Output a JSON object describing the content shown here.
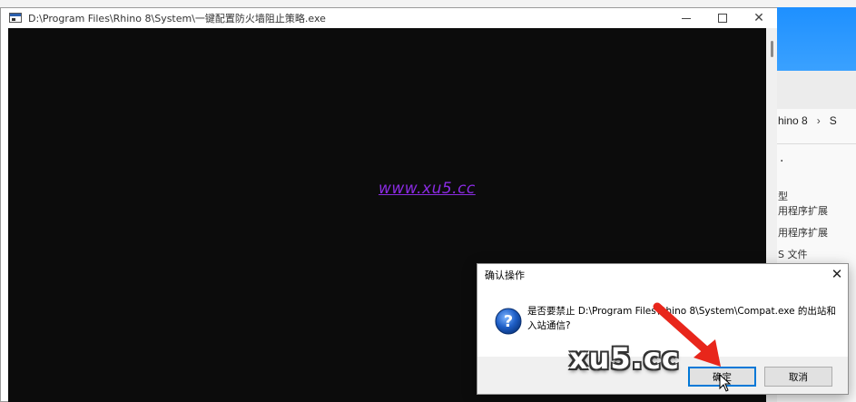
{
  "explorer": {
    "breadcrumb": [
      "hino 8",
      "S"
    ],
    "items": [
      "型",
      "用程序扩展",
      "用程序扩展",
      "S 文件"
    ]
  },
  "console": {
    "title": "D:\\Program Files\\Rhino 8\\System\\一键配置防火墙阻止策略.exe",
    "watermark": "www.xu5.cc"
  },
  "dialog": {
    "title": "确认操作",
    "message": "是否要禁止 D:\\Program Files\\Rhino 8\\System\\Compat.exe 的出站和入站通信?",
    "ok_label": "确定",
    "cancel_label": "取消"
  },
  "overlay": {
    "watermark": "xu5.cc"
  },
  "colors": {
    "console_bg": "#0c0c0c",
    "watermark_purple": "#8a2be2",
    "accent_blue": "#0078d7",
    "arrow_red": "#e8261b"
  }
}
